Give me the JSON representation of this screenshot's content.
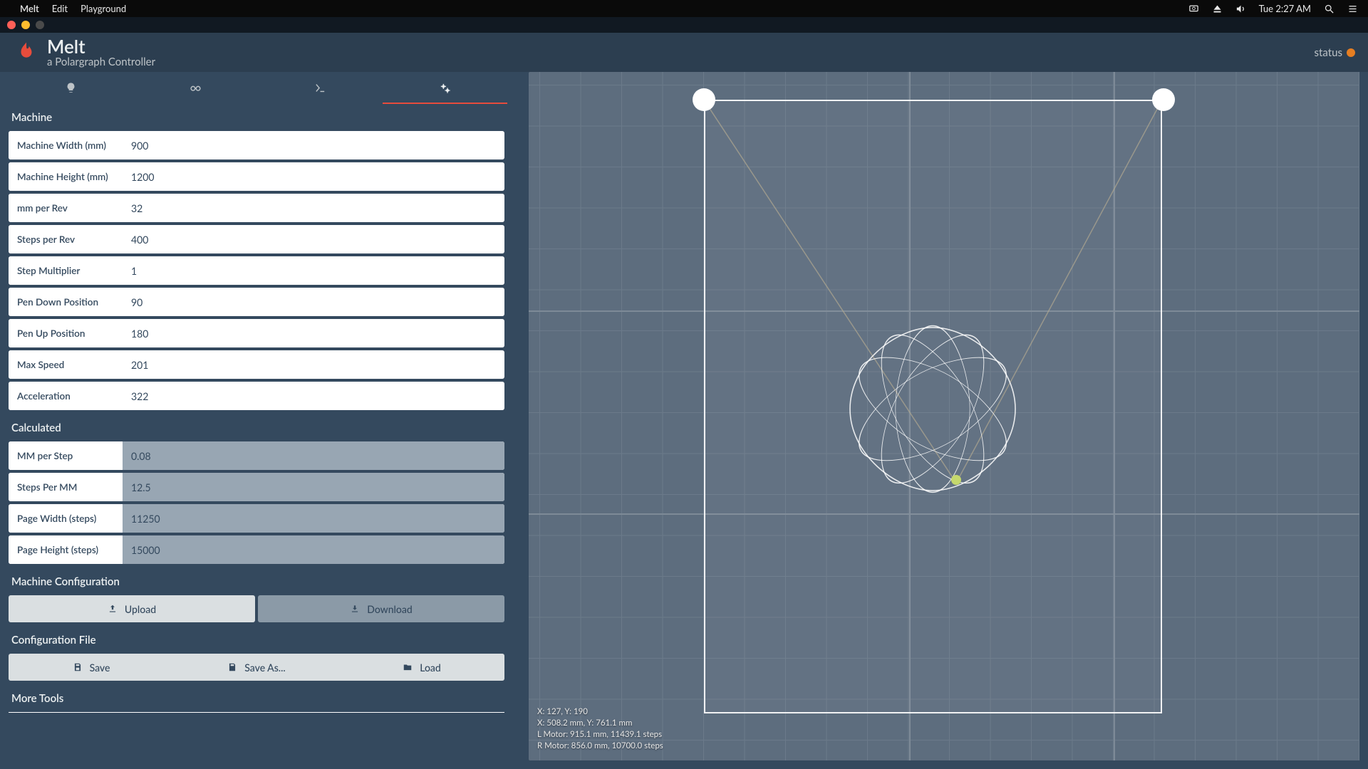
{
  "menubar": {
    "app": "Melt",
    "items": [
      "Edit",
      "Playground"
    ],
    "clock": "Tue 2:27 AM"
  },
  "header": {
    "title": "Melt",
    "subtitle": "a Polargraph Controller",
    "status_label": "status"
  },
  "sections": {
    "machine": {
      "title": "Machine",
      "fields": [
        {
          "label": "Machine Width (mm)",
          "value": "900"
        },
        {
          "label": "Machine Height (mm)",
          "value": "1200"
        },
        {
          "label": "mm per Rev",
          "value": "32"
        },
        {
          "label": "Steps per Rev",
          "value": "400"
        },
        {
          "label": "Step Multiplier",
          "value": "1"
        },
        {
          "label": "Pen Down Position",
          "value": "90"
        },
        {
          "label": "Pen Up Position",
          "value": "180"
        },
        {
          "label": "Max Speed",
          "value": "201"
        },
        {
          "label": "Acceleration",
          "value": "322"
        }
      ]
    },
    "calculated": {
      "title": "Calculated",
      "fields": [
        {
          "label": "MM per Step",
          "value": "0.08"
        },
        {
          "label": "Steps Per MM",
          "value": "12.5"
        },
        {
          "label": "Page Width (steps)",
          "value": "11250"
        },
        {
          "label": "Page Height (steps)",
          "value": "15000"
        }
      ]
    },
    "machine_config": {
      "title": "Machine Configuration",
      "upload": "Upload",
      "download": "Download"
    },
    "config_file": {
      "title": "Configuration File",
      "save": "Save",
      "save_as": "Save As...",
      "load": "Load"
    },
    "more_tools": {
      "title": "More Tools"
    }
  },
  "canvas": {
    "readout": {
      "l1": "X: 127, Y: 190",
      "l2": "X: 508.2 mm, Y: 761.1 mm",
      "l3": "L Motor: 915.1 mm, 11439.1 steps",
      "l4": "R Motor: 856.0 mm, 10700.0 steps"
    }
  }
}
